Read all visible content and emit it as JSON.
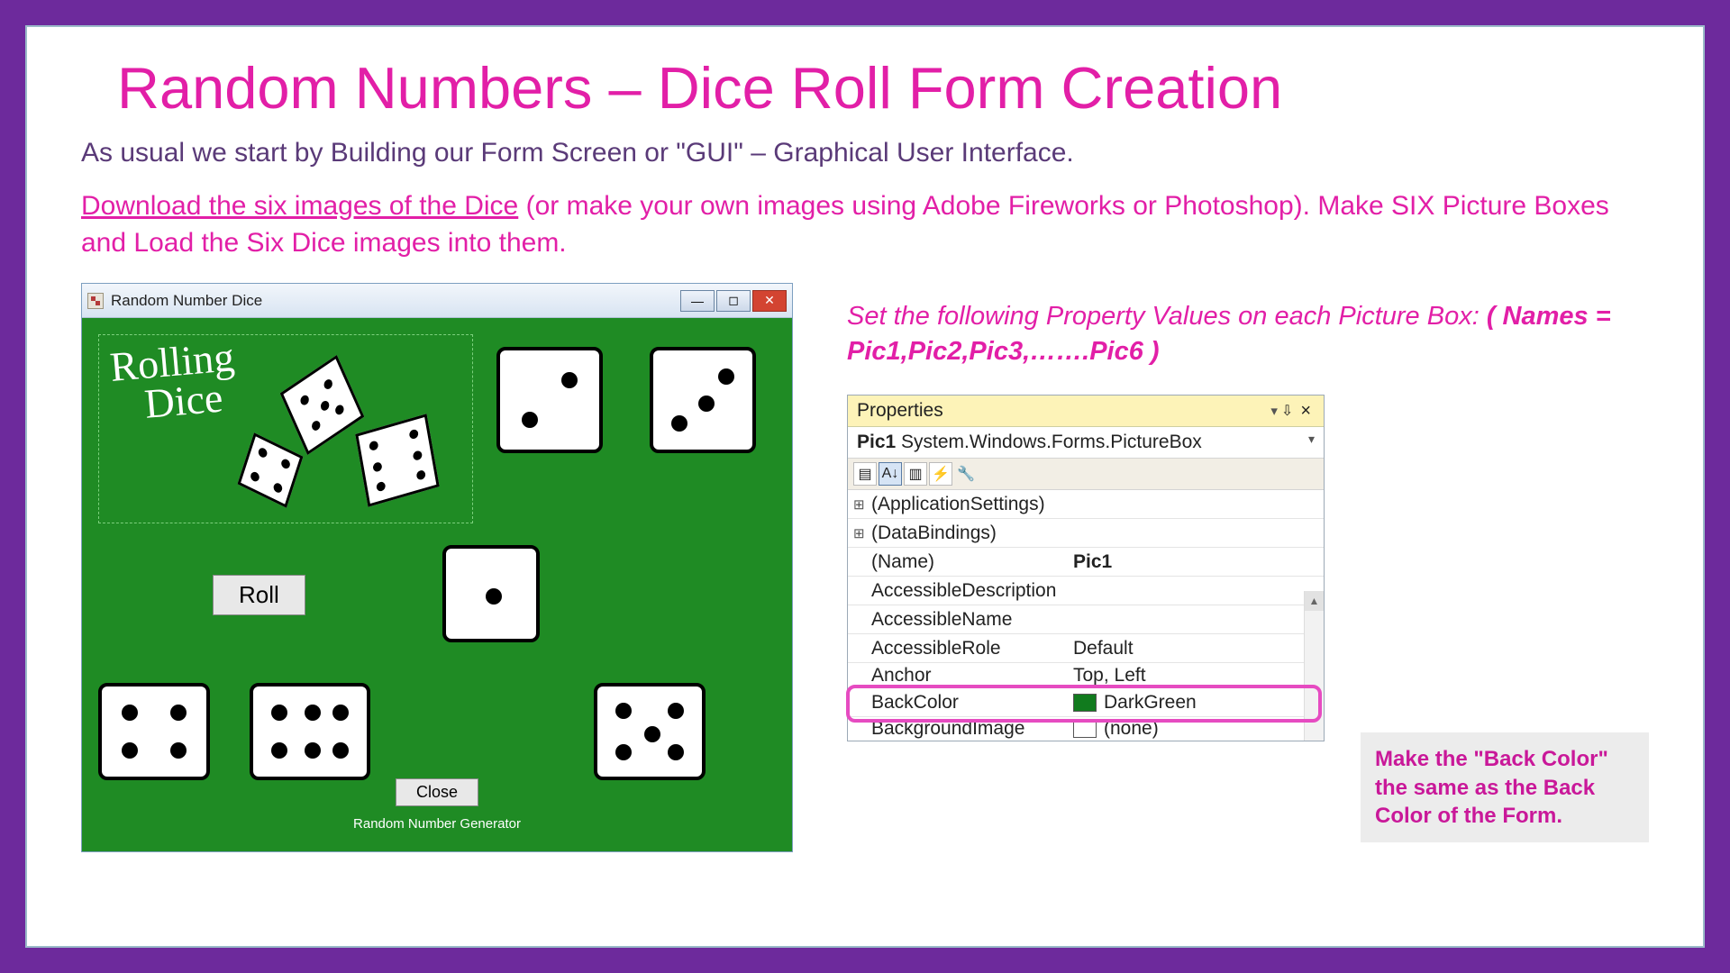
{
  "slide": {
    "title": "Random Numbers – Dice Roll Form Creation",
    "intro": "As usual we start by Building our Form Screen or \"GUI\" – Graphical User Interface.",
    "link_text": "Download the six images of the Dice",
    "para2_rest": " (or make your own images using Adobe Fireworks or Photoshop). Make SIX Picture Boxes and Load the Six Dice images into them.",
    "instr_italic": "Set the following Property Values on each Picture Box:  ",
    "instr_bold": "( Names = Pic1,Pic2,Pic3,…….Pic6 )",
    "callout": "Make the \"Back Color\" the same as the Back Color of the Form."
  },
  "form": {
    "title": "Random Number Dice",
    "rolling_line1": "Rolling",
    "rolling_line2": "Dice",
    "roll_btn": "Roll",
    "close_btn": "Close",
    "generator": "Random Number Generator"
  },
  "props": {
    "header": "Properties",
    "pin": "⇩",
    "close": "×",
    "sub_bold": "Pic1",
    "sub_rest": " System.Windows.Forms.PictureBox",
    "rows": {
      "appsettings": "(ApplicationSettings)",
      "databindings": "(DataBindings)",
      "name_label": "(Name)",
      "name_value": "Pic1",
      "accdesc": "AccessibleDescription",
      "accname": "AccessibleName",
      "accrole_label": "AccessibleRole",
      "accrole_value": "Default",
      "anchor_label": "Anchor",
      "anchor_value": "Top, Left",
      "backcolor_label": "BackColor",
      "backcolor_value": "DarkGreen",
      "bgimg_label": "BackgroundImage",
      "bgimg_value": "(none)"
    }
  }
}
